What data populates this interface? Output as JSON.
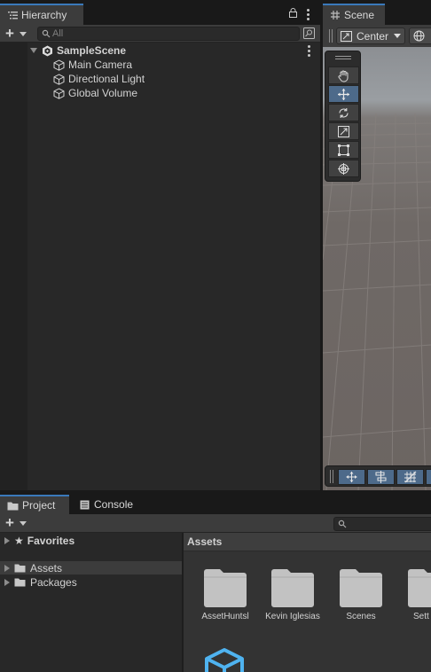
{
  "hierarchy": {
    "tab_label": "Hierarchy",
    "search_placeholder": "All",
    "scene_name": "SampleScene",
    "items": [
      {
        "label": "Main Camera"
      },
      {
        "label": "Directional Light"
      },
      {
        "label": "Global Volume"
      }
    ]
  },
  "scene": {
    "tab_label": "Scene",
    "pivot_mode": "Center",
    "tools": [
      "hand-tool",
      "move-tool",
      "rotate-tool",
      "scale-tool",
      "rect-tool",
      "transform-tool"
    ],
    "active_tool": "move-tool"
  },
  "project": {
    "tabs": [
      {
        "label": "Project"
      },
      {
        "label": "Console"
      }
    ],
    "tree": {
      "favorites": "Favorites",
      "assets": "Assets",
      "packages": "Packages"
    },
    "breadcrumb": "Assets",
    "assets": [
      {
        "label": "AssetHuntsl"
      },
      {
        "label": "Kevin Iglesias"
      },
      {
        "label": "Scenes"
      },
      {
        "label": "Sett"
      }
    ]
  },
  "colors": {
    "accent": "#3a79bb",
    "panel": "#282828",
    "toolbar": "#3c3c3c",
    "active_tool": "#4d6a8a",
    "prefab_blue": "#4fb3f0"
  }
}
